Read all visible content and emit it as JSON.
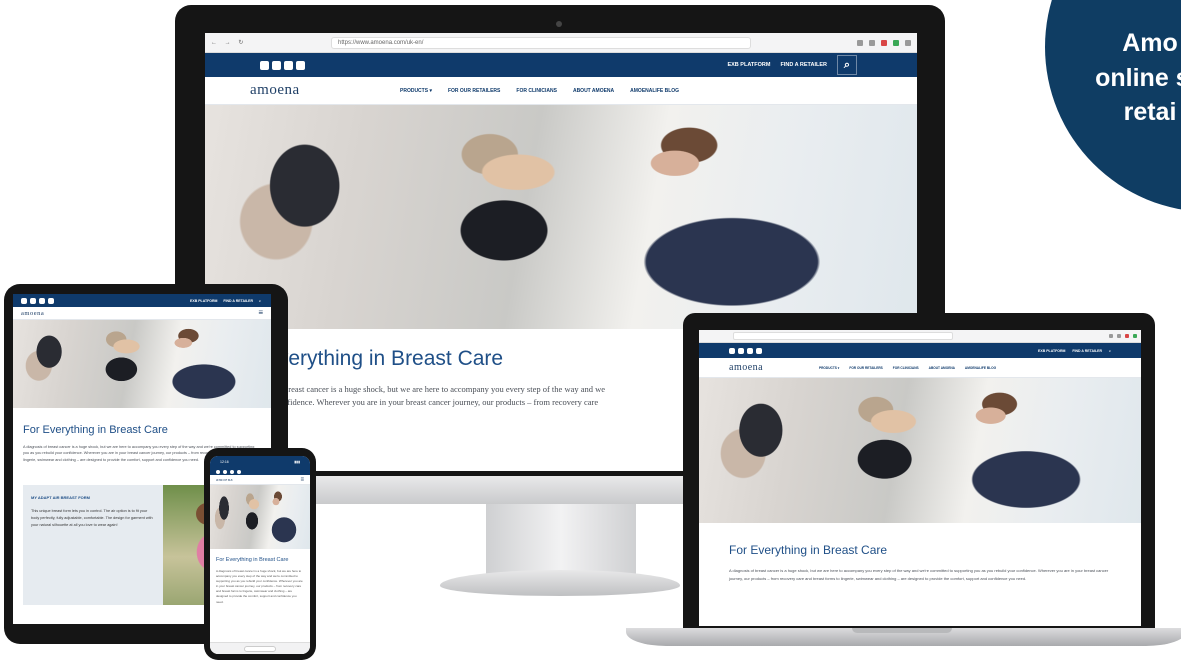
{
  "badge": {
    "line1": "Amo",
    "line2": "online sh",
    "line3": "retai"
  },
  "site": {
    "logo": "amoena",
    "util_links": [
      "EXB PLATFORM",
      "FIND A RETAILER"
    ],
    "nav": [
      "PRODUCTS ▾",
      "FOR OUR RETAILERS",
      "FOR CLINICIANS",
      "ABOUT AMOENA",
      "AMOENALIFE BLOG"
    ],
    "hero_title": "For Everything in Breast Care",
    "monitor_title": "r Everything in Breast Care",
    "monitor_text_line1": "gnosis of breast cancer is a huge shock, but we are here to accompany you every step of the way and we",
    "monitor_text_line2": "d your confidence. Wherever you are in your breast cancer journey, our products – from recovery care",
    "intro": "A diagnosis of breast cancer is a huge shock, but we are here to accompany you every step of the way and we're committed to supporting you as you rebuild your confidence. Wherever you are in your breast cancer journey, our products – from recovery care and breast forms to lingerie, swimwear and clothing – are designed to provide the comfort, support and confidence you need.",
    "card_title": "MY ADAPT AIR BREAST FORM",
    "card_text": "This unique breast form lets you in control. The air option is to fit your body perfectly, fully adjustable, comfortable. The design for garment with your natural silhouette at all you love to wear again!"
  },
  "browser": {
    "url": "https://www.amoena.com/uk-en/"
  },
  "phone": {
    "time": "12:16"
  }
}
